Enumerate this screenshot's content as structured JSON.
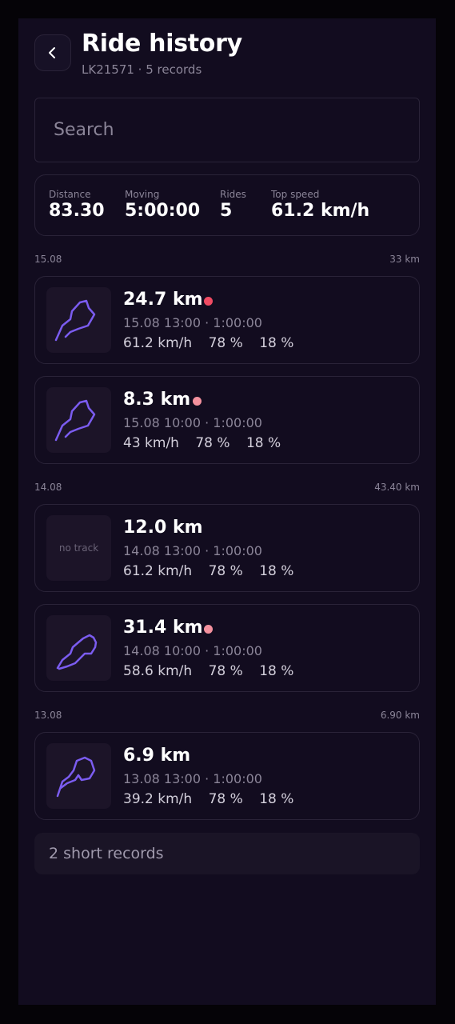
{
  "header": {
    "title": "Ride history",
    "subtitle": "LK21571 · 5 records",
    "back_icon": "chevron-left-icon"
  },
  "search": {
    "placeholder": "Search",
    "value": ""
  },
  "stats": {
    "distance": {
      "label": "Distance",
      "value": "83.30"
    },
    "moving": {
      "label": "Moving",
      "value": "5:00:00"
    },
    "rides": {
      "label": "Rides",
      "value": "5"
    },
    "top_speed": {
      "label": "Top speed",
      "value": "61.2 km/h"
    }
  },
  "days": [
    {
      "date": "15.08",
      "total": "33 km",
      "rides": [
        {
          "distance": "24.7 km",
          "time": "15.08 13:00 · 1:00:00",
          "speed": "61.2 km/h",
          "pct1": "78 %",
          "pct2": "18 %",
          "has_track": true,
          "dot_color": "#f04b63"
        },
        {
          "distance": "8.3 km",
          "time": "15.08 10:00 · 1:00:00",
          "speed": "43 km/h",
          "pct1": "78 %",
          "pct2": "18 %",
          "has_track": true,
          "dot_color": "#f4919e"
        }
      ]
    },
    {
      "date": "14.08",
      "total": "43.40 km",
      "rides": [
        {
          "distance": "12.0 km",
          "time": "14.08 13:00 · 1:00:00",
          "speed": "61.2 km/h",
          "pct1": "78 %",
          "pct2": "18 %",
          "has_track": false,
          "no_track_label": "no track"
        },
        {
          "distance": "31.4 km",
          "time": "14.08 10:00 · 1:00:00",
          "speed": "58.6 km/h",
          "pct1": "78 %",
          "pct2": "18 %",
          "has_track": true,
          "dot_color": "#f4919e"
        }
      ]
    },
    {
      "date": "13.08",
      "total": "6.90 km",
      "rides": [
        {
          "distance": "6.9 km",
          "time": "13.08 13:00 · 1:00:00",
          "speed": "39.2 km/h",
          "pct1": "78 %",
          "pct2": "18 %",
          "has_track": true
        }
      ]
    }
  ],
  "footer": {
    "short_records": "2 short records"
  },
  "colors": {
    "background": "#120c1f",
    "border": "#2a2338",
    "track": "#7b5cf0",
    "muted_text": "#8b8598"
  }
}
